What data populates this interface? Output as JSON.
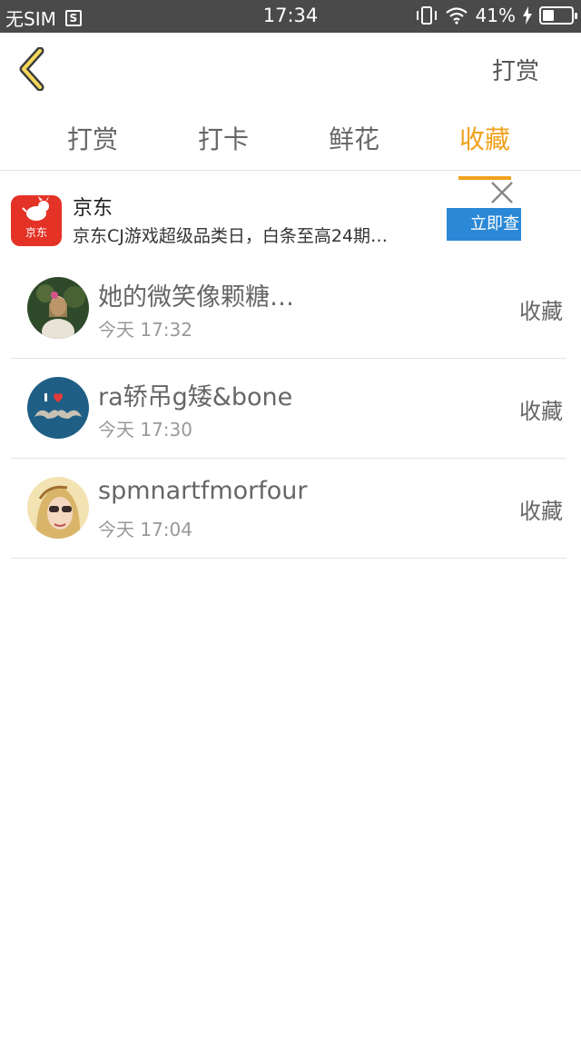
{
  "status_bar": {
    "carrier": "无SIM",
    "sim_icon_label": "S",
    "time": "17:34",
    "battery": "41%",
    "battery_level": 0.41
  },
  "header": {
    "right_action": "打赏"
  },
  "tabs": [
    {
      "label": "打赏"
    },
    {
      "label": "打卡"
    },
    {
      "label": "鲜花"
    },
    {
      "label": "收藏"
    }
  ],
  "active_tab": 3,
  "ad": {
    "logo_text": "京东",
    "title": "京东",
    "description": "京东CJ游戏超级品类日，白条至高24期…",
    "cta": "立即查"
  },
  "list": [
    {
      "name": "她的微笑像颗糖…",
      "time": "今天 17:32",
      "action": "收藏"
    },
    {
      "name": "ra轿吊g矮&bone",
      "time": "今天 17:30",
      "action": "收藏"
    },
    {
      "name": "spmnartfmorfour",
      "time": "今天 17:04",
      "action": "收藏"
    }
  ],
  "colors": {
    "accent": "#f0a11b",
    "status_bar": "#4a4a4a",
    "ad_button": "#2b88d6",
    "ad_logo": "#e43226"
  }
}
